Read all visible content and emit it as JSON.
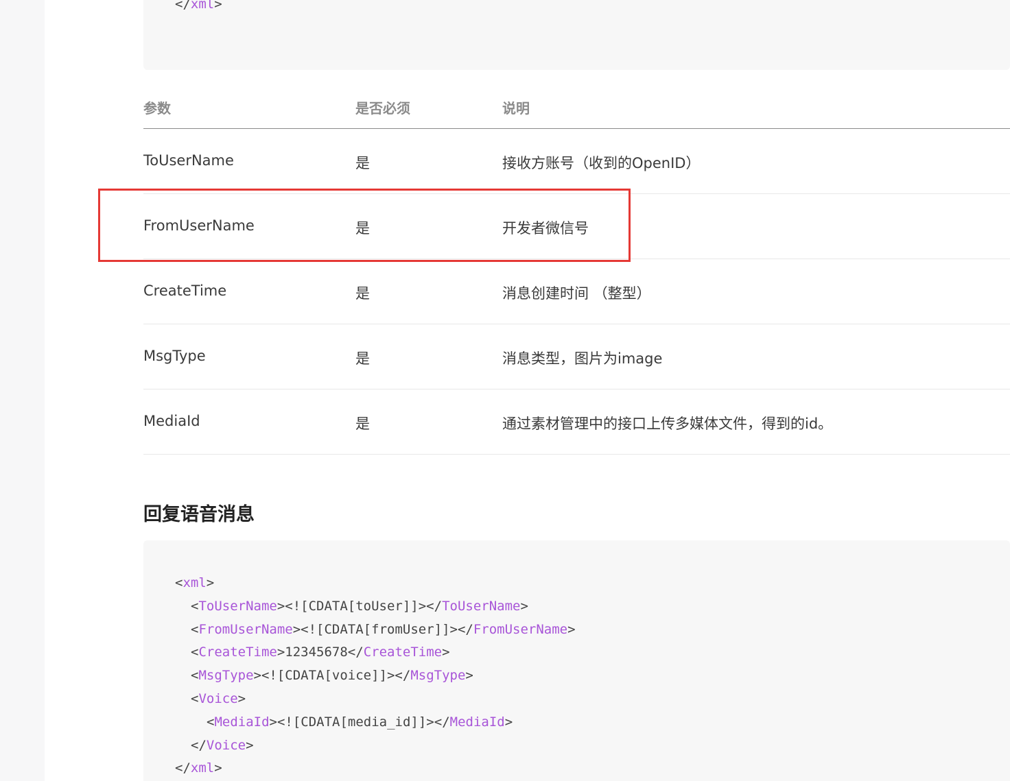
{
  "code_top": {
    "lines": [
      {
        "indent": 0,
        "parts": [
          {
            "t": "</",
            "c": "punct"
          },
          {
            "t": "xml",
            "c": "tag"
          },
          {
            "t": ">",
            "c": "punct"
          }
        ]
      }
    ]
  },
  "table": {
    "headers": [
      "参数",
      "是否必须",
      "说明"
    ],
    "rows": [
      {
        "param": "ToUserName",
        "required": "是",
        "desc": "接收方账号（收到的OpenID）"
      },
      {
        "param": "FromUserName",
        "required": "是",
        "desc": "开发者微信号"
      },
      {
        "param": "CreateTime",
        "required": "是",
        "desc": "消息创建时间 （整型）"
      },
      {
        "param": "MsgType",
        "required": "是",
        "desc": "消息类型，图片为image"
      },
      {
        "param": "MediaId",
        "required": "是",
        "desc": "通过素材管理中的接口上传多媒体文件，得到的id。"
      }
    ]
  },
  "section": {
    "title": "回复语音消息"
  },
  "code_bottom": {
    "lines": [
      {
        "indent": 0,
        "parts": [
          {
            "t": "<",
            "c": "punct"
          },
          {
            "t": "xml",
            "c": "tag"
          },
          {
            "t": ">",
            "c": "punct"
          }
        ]
      },
      {
        "indent": 1,
        "parts": [
          {
            "t": "<",
            "c": "punct"
          },
          {
            "t": "ToUserName",
            "c": "tag"
          },
          {
            "t": "><![CDATA[toUser]]></",
            "c": "punct"
          },
          {
            "t": "ToUserName",
            "c": "tag"
          },
          {
            "t": ">",
            "c": "punct"
          }
        ]
      },
      {
        "indent": 1,
        "parts": [
          {
            "t": "<",
            "c": "punct"
          },
          {
            "t": "FromUserName",
            "c": "tag"
          },
          {
            "t": "><![CDATA[fromUser]]></",
            "c": "punct"
          },
          {
            "t": "FromUserName",
            "c": "tag"
          },
          {
            "t": ">",
            "c": "punct"
          }
        ]
      },
      {
        "indent": 1,
        "parts": [
          {
            "t": "<",
            "c": "punct"
          },
          {
            "t": "CreateTime",
            "c": "tag"
          },
          {
            "t": ">12345678</",
            "c": "punct"
          },
          {
            "t": "CreateTime",
            "c": "tag"
          },
          {
            "t": ">",
            "c": "punct"
          }
        ]
      },
      {
        "indent": 1,
        "parts": [
          {
            "t": "<",
            "c": "punct"
          },
          {
            "t": "MsgType",
            "c": "tag"
          },
          {
            "t": "><![CDATA[voice]]></",
            "c": "punct"
          },
          {
            "t": "MsgType",
            "c": "tag"
          },
          {
            "t": ">",
            "c": "punct"
          }
        ]
      },
      {
        "indent": 1,
        "parts": [
          {
            "t": "<",
            "c": "punct"
          },
          {
            "t": "Voice",
            "c": "tag"
          },
          {
            "t": ">",
            "c": "punct"
          }
        ]
      },
      {
        "indent": 2,
        "parts": [
          {
            "t": "<",
            "c": "punct"
          },
          {
            "t": "MediaId",
            "c": "tag"
          },
          {
            "t": "><![CDATA[media_id]]></",
            "c": "punct"
          },
          {
            "t": "MediaId",
            "c": "tag"
          },
          {
            "t": ">",
            "c": "punct"
          }
        ]
      },
      {
        "indent": 1,
        "parts": [
          {
            "t": "</",
            "c": "punct"
          },
          {
            "t": "Voice",
            "c": "tag"
          },
          {
            "t": ">",
            "c": "punct"
          }
        ]
      },
      {
        "indent": 0,
        "parts": [
          {
            "t": "</",
            "c": "punct"
          },
          {
            "t": "xml",
            "c": "tag"
          },
          {
            "t": ">",
            "c": "punct"
          }
        ]
      }
    ]
  }
}
